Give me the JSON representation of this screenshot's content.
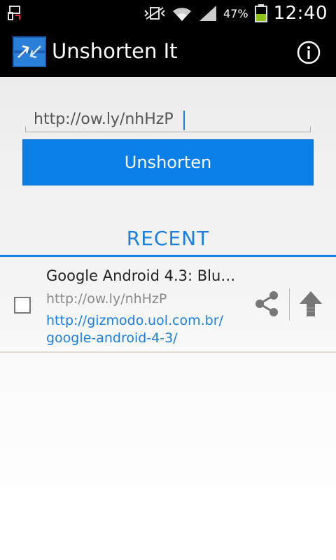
{
  "status_bar": {
    "battery_percent": "47%",
    "time": "12:40"
  },
  "action_bar": {
    "title": "Unshorten It",
    "logo_icon": "unshorten-logo-icon",
    "info_icon": "info-icon"
  },
  "input": {
    "value": "http://ow.ly/nhHzP"
  },
  "button": {
    "label": "Unshorten"
  },
  "recent": {
    "header": "RECENT",
    "items": [
      {
        "title": "Google Android 4.3: Blu…",
        "short_url": "http://ow.ly/nhHzP",
        "long_url": "http://gizmodo.uol.com.br/google-android-4-3/",
        "long_url_line1": "http://gizmodo.uol.com.br/",
        "long_url_line2": "google-android-4-3/"
      }
    ]
  },
  "colors": {
    "accent": "#1a7fe0",
    "button": "#0a7fe8",
    "bar": "#000000"
  }
}
